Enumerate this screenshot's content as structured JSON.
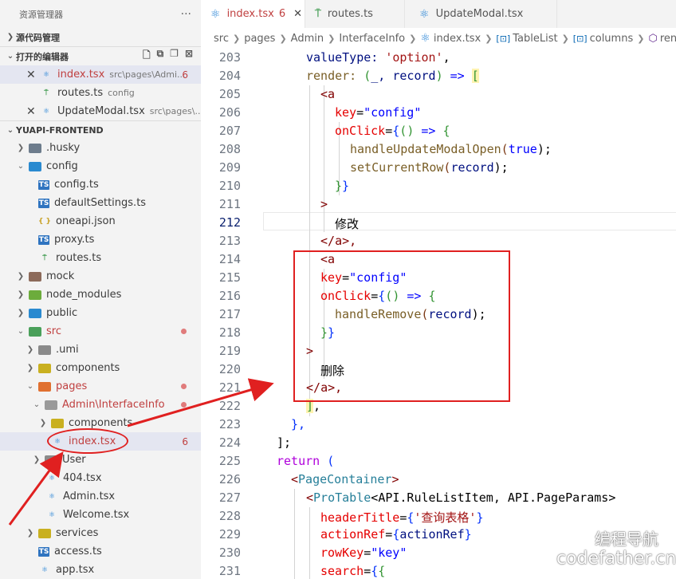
{
  "explorer": {
    "title": "资源管理器",
    "more": "···",
    "source_control": "源代码管理",
    "open_editors": "打开的编辑器",
    "open_files": [
      {
        "name": "index.tsx",
        "path": "src\\pages\\Admi...",
        "badge": "6"
      },
      {
        "name": "routes.ts",
        "path": "config"
      },
      {
        "name": "UpdateModal.tsx",
        "path": "src\\pages\\..."
      }
    ],
    "project": "YUAPI-FRONTEND",
    "tree": [
      {
        "label": ".husky"
      },
      {
        "label": "config"
      },
      {
        "label": "config.ts"
      },
      {
        "label": "defaultSettings.ts"
      },
      {
        "label": "oneapi.json"
      },
      {
        "label": "proxy.ts"
      },
      {
        "label": "routes.ts"
      },
      {
        "label": "mock"
      },
      {
        "label": "node_modules"
      },
      {
        "label": "public"
      },
      {
        "label": "src"
      },
      {
        "label": ".umi"
      },
      {
        "label": "components"
      },
      {
        "label": "pages"
      },
      {
        "label": "Admin\\InterfaceInfo"
      },
      {
        "label": "components"
      },
      {
        "label": "index.tsx",
        "badge": "6"
      },
      {
        "label": "User"
      },
      {
        "label": "404.tsx"
      },
      {
        "label": "Admin.tsx"
      },
      {
        "label": "Welcome.tsx"
      },
      {
        "label": "services"
      },
      {
        "label": "access.ts"
      },
      {
        "label": "app.tsx"
      }
    ]
  },
  "tabs": [
    {
      "label": "index.tsx",
      "badge": "6"
    },
    {
      "label": "routes.ts"
    },
    {
      "label": "UpdateModal.tsx"
    }
  ],
  "breadcrumb": [
    "src",
    "pages",
    "Admin",
    "InterfaceInfo",
    "index.tsx",
    "TableList",
    "columns",
    "render"
  ],
  "line_numbers": [
    "203",
    "204",
    "205",
    "206",
    "207",
    "208",
    "209",
    "210",
    "211",
    "212",
    "213",
    "214",
    "215",
    "216",
    "217",
    "218",
    "219",
    "220",
    "221",
    "222",
    "223",
    "224",
    "225",
    "226",
    "227",
    "228",
    "229",
    "230",
    "231"
  ],
  "code": {
    "l203": [
      "valueType: ",
      "'option'",
      ","
    ],
    "l204": [
      "render: ",
      "(",
      "_, record",
      ")",
      " => ",
      "["
    ],
    "l205": [
      "<",
      "a"
    ],
    "l206": [
      "key",
      "=",
      "\"config\""
    ],
    "l207": [
      "onClick",
      "=",
      "{",
      "(",
      ")",
      " => ",
      "{"
    ],
    "l208": [
      "handleUpdateModalOpen",
      "(",
      "true",
      ");"
    ],
    "l209": [
      "setCurrentRow",
      "(",
      "record",
      ");"
    ],
    "l210": [
      "}",
      "}"
    ],
    "l211": [
      ">"
    ],
    "l212": [
      "修改"
    ],
    "l213": [
      "</",
      "a",
      ">,"
    ],
    "l214": [
      "<",
      "a"
    ],
    "l215": [
      "key",
      "=",
      "\"config\""
    ],
    "l216": [
      "onClick",
      "=",
      "{",
      "(",
      ")",
      " => ",
      "{"
    ],
    "l217": [
      "handleRemove",
      "(",
      "record",
      ");"
    ],
    "l218": [
      "}",
      "}"
    ],
    "l219": [
      ">"
    ],
    "l220": [
      "删除"
    ],
    "l221": [
      "</",
      "a",
      ">,"
    ],
    "l222": [
      "]",
      ","
    ],
    "l223": [
      "},"
    ],
    "l224": [
      "];"
    ],
    "l225": [
      "return",
      " ",
      "("
    ],
    "l226": [
      "<",
      "PageContainer",
      ">"
    ],
    "l227": [
      "<",
      "ProTable",
      "<",
      "API.RuleListItem",
      ", ",
      "API.PageParams",
      ">"
    ],
    "l228": [
      "headerTitle",
      "=",
      "{",
      "'查询表格'",
      "}"
    ],
    "l229": [
      "actionRef",
      "=",
      "{",
      "actionRef",
      "}"
    ],
    "l230": [
      "rowKey",
      "=",
      "\"key\""
    ],
    "l231": [
      "search",
      "=",
      "{",
      "{"
    ]
  },
  "watermark": {
    "line1": "编程导航",
    "line2": "codefather.cn"
  }
}
